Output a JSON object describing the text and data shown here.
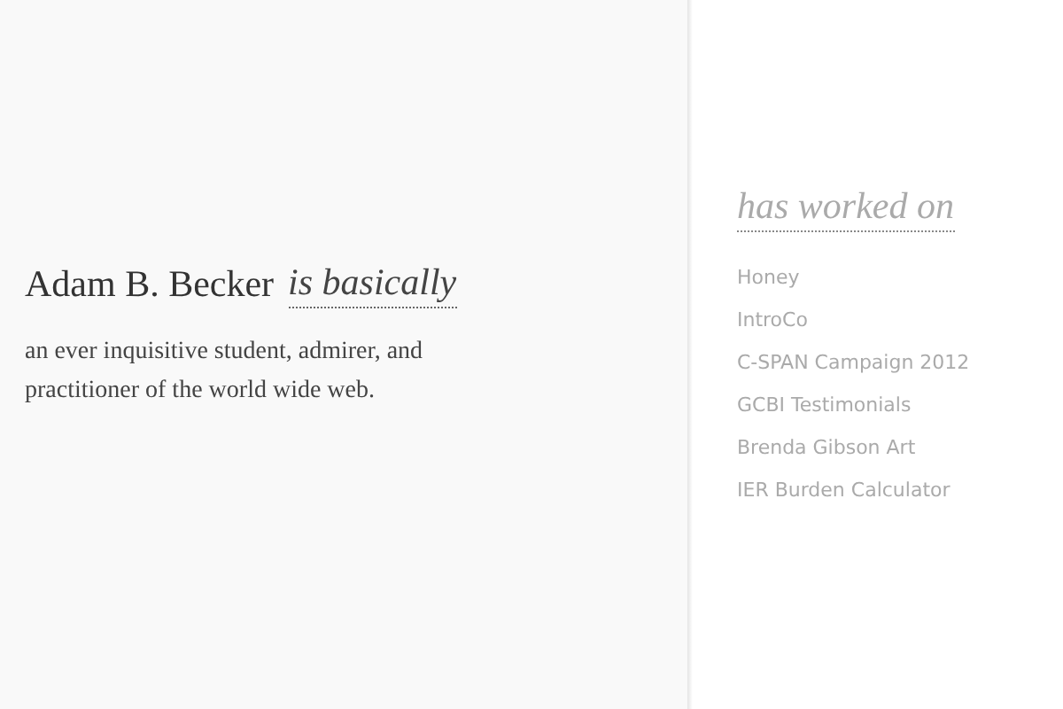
{
  "intro": {
    "name": "Adam B. Becker",
    "connector": "is basically",
    "description": "an ever inquisitive student, admirer, and practitioner of the world wide web."
  },
  "projects": {
    "heading": "has worked on",
    "items": [
      "Honey",
      "IntroCo",
      "C-SPAN Campaign 2012",
      "GCBI Testimonials",
      "Brenda Gibson Art",
      "IER Burden Calculator"
    ]
  }
}
